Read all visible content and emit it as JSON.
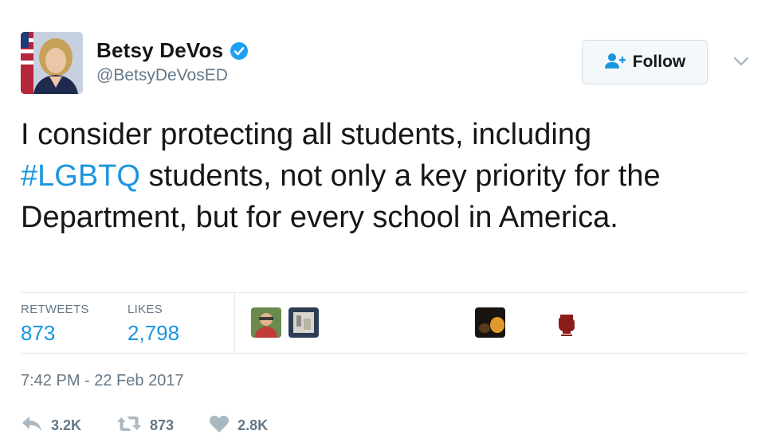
{
  "tweet": {
    "author": {
      "display_name": "Betsy DeVos",
      "handle": "@BetsyDeVosED",
      "verified": true,
      "avatar_icon": "profile-photo"
    },
    "follow_button_label": "Follow",
    "text": {
      "part1": "I consider protecting all students, including",
      "hashtag": "#LGBTQ",
      "part2": " students, not only a key priority for the Department, but for every school in America."
    },
    "stats": {
      "retweets_label": "RETWEETS",
      "retweets_value": "873",
      "likes_label": "LIKES",
      "likes_value": "2,798"
    },
    "likers": [
      {
        "icon": "liker-avatar-person"
      },
      {
        "icon": "liker-avatar-artwork"
      },
      {
        "icon": "liker-avatar-dark"
      },
      {
        "icon": "liker-avatar-fist"
      }
    ],
    "timestamp": "7:42 PM - 22 Feb 2017",
    "actions": {
      "reply_count": "3.2K",
      "retweet_count": "873",
      "like_count": "2.8K"
    }
  },
  "colors": {
    "accent": "#1b95e0",
    "muted": "#657786",
    "text": "#14171a",
    "border": "#e1e8ed"
  }
}
